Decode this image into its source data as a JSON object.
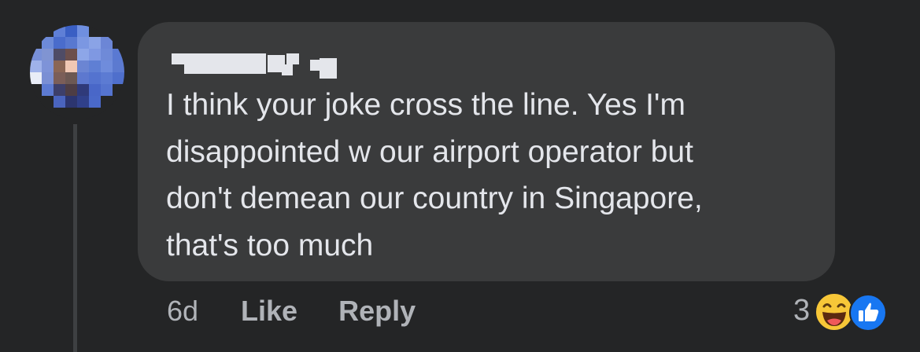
{
  "comment": {
    "author_name": "",
    "text": "I think your joke cross the line. Yes I'm\ndisappointed w our airport operator but\ndon't demean our country in Singapore,\nthat's too much",
    "timestamp": "6d",
    "like_label": "Like",
    "reply_label": "Reply",
    "reaction_count": "3",
    "reaction_icons": [
      "haha-icon",
      "like-react-icon"
    ]
  },
  "colors": {
    "background": "#242526",
    "bubble": "#3a3b3c",
    "text": "#e4e6eb",
    "secondary_text": "#b0b3b8",
    "like_blue": "#1877f2",
    "haha_yellow": "#f7c738"
  }
}
